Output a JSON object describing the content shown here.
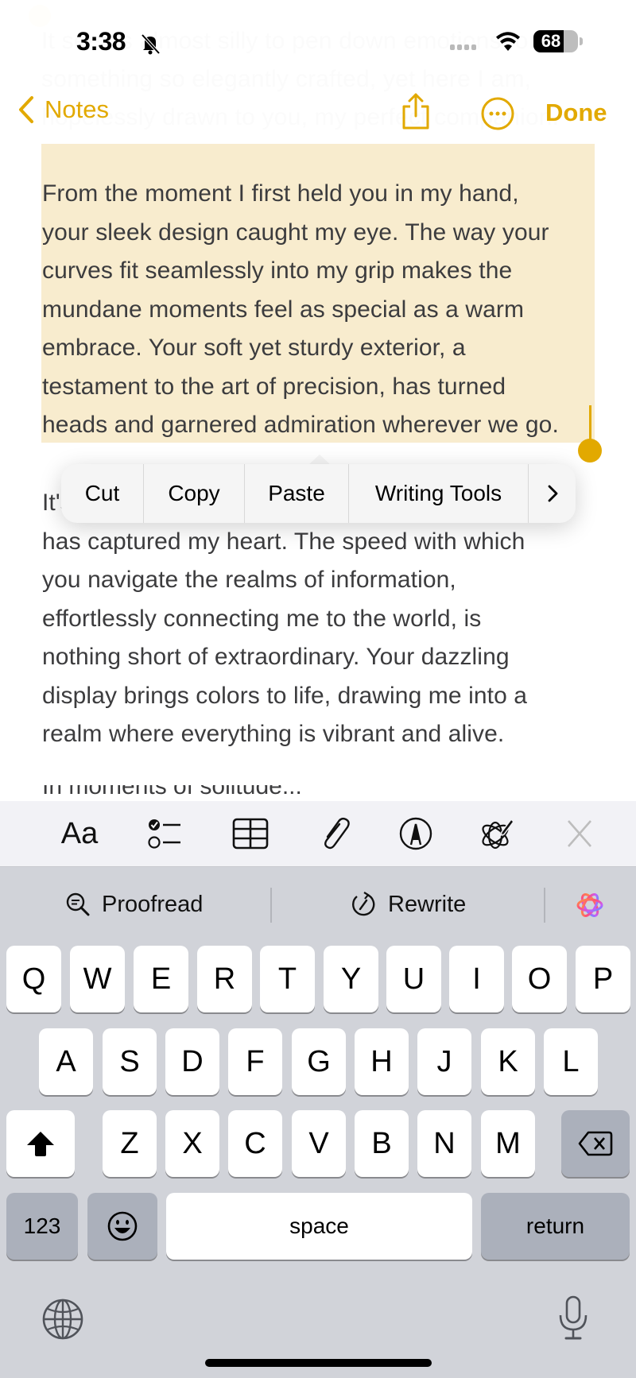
{
  "status_bar": {
    "time": "3:38",
    "silent_icon": "bell-slash-icon",
    "wifi_icon": "wifi-icon",
    "battery_percent": 68,
    "battery_label": "68"
  },
  "nav": {
    "back_label": "Notes",
    "share_icon": "share-icon",
    "more_icon": "ellipsis-circle-icon",
    "done_label": "Done"
  },
  "note": {
    "ghost_text": "It seems almost silly to pen down emotions for something so elegantly crafted, yet here I am, hopelessly drawn to you, my perfect companion.",
    "selected_paragraph_lines": [
      "From the moment I first held you in my hand,",
      "your sleek design caught my eye. The way your",
      "curves fit seamlessly into my grip makes the",
      "mundane moments feel as special as a warm",
      "embrace. Your soft yet sturdy exterior, a",
      "testament to the art of precision, has turned",
      "heads and garnered admiration wherever we go."
    ],
    "second_paragraph_lines": [
      "It's not just your appearance, though, that",
      "has captured my heart. The speed with which",
      "you navigate the realms of information,",
      "effortlessly connecting me to the world, is",
      "nothing short of extraordinary. Your dazzling",
      "display brings colors to life, drawing me into a",
      "realm where everything is vibrant and alive."
    ],
    "clipped_line": "In moments of solitude..."
  },
  "edit_menu": {
    "items": [
      "Cut",
      "Copy",
      "Paste",
      "Writing Tools"
    ],
    "more_icon": "chevron-right-icon"
  },
  "toolbar": {
    "format_label": "Aa",
    "items": [
      "checklist-icon",
      "table-icon",
      "paperclip-icon",
      "markup-pen-icon",
      "writing-tools-icon",
      "close-icon"
    ]
  },
  "keyboard": {
    "suggestions": {
      "proofread": "Proofread",
      "rewrite": "Rewrite"
    },
    "row1": [
      "Q",
      "W",
      "E",
      "R",
      "T",
      "Y",
      "U",
      "I",
      "O",
      "P"
    ],
    "row2": [
      "A",
      "S",
      "D",
      "F",
      "G",
      "H",
      "J",
      "K",
      "L"
    ],
    "row3": [
      "Z",
      "X",
      "C",
      "V",
      "B",
      "N",
      "M"
    ],
    "numbers_label": "123",
    "space_label": "space",
    "return_label": "return"
  },
  "colors": {
    "accent": "#e2a900",
    "selection": "#f8ecce",
    "keyboard_bg": "#d1d3d9"
  }
}
